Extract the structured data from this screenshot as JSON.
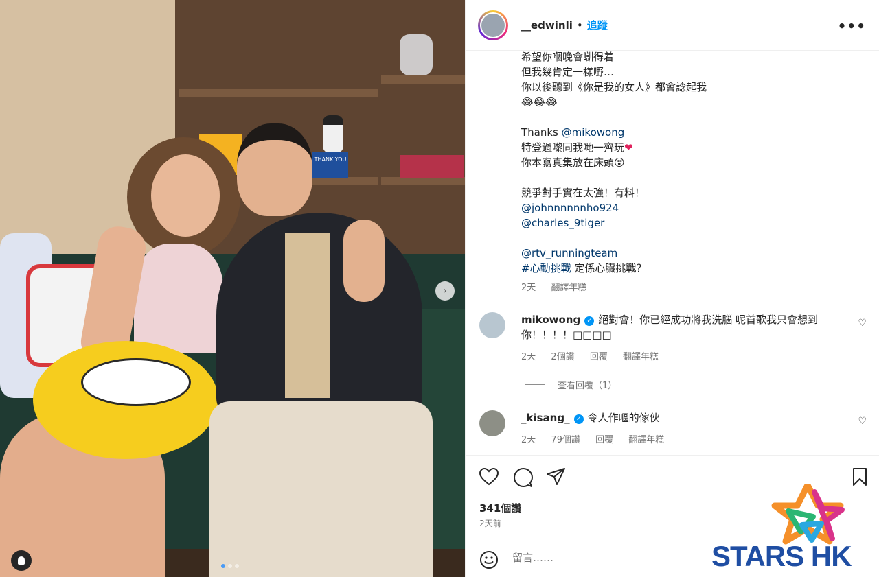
{
  "post": {
    "username": "__edwinli",
    "follow_label": "追蹤",
    "separator": "•",
    "more_label": "•••"
  },
  "photo": {
    "sign_text": "THANK YOU",
    "carousel_index": 1,
    "carousel_total": 3
  },
  "caption": {
    "lines": [
      "希望你嗰晚會瞓得着",
      "但我幾肯定一樣嘢…",
      "你以後聽到《你是我的女人》都會諗起我",
      "😂😂😂",
      "",
      "Thanks @mikowong",
      "特登過嚟同我哋一齊玩",
      "你本寫真集放在床頭😵",
      "",
      "競爭對手實在太強！有料！",
      "@johnnnnnnho924",
      "@charles_9tiger",
      "",
      "@rtv_runningteam",
      "#心動挑戰 定係心臟挑戰？"
    ],
    "thanks_prefix": "Thanks ",
    "mention_miko": "@mikowong",
    "line_visit": "特登過嚟同我哋一齊玩",
    "heart": "❤",
    "mention_john": "@johnnnnnnho924",
    "mention_charles": "@charles_9tiger",
    "mention_rtv": "@rtv_runningteam",
    "hashtag": "#心動挑戰",
    "hashtag_rest": " 定係心臟挑戰？",
    "time": "2天",
    "translate": "翻譯年糕"
  },
  "comments": [
    {
      "username": "mikowong",
      "text_line1": "絕對會！你已經成功將我洗腦 呢首歌我只會想到",
      "text_line2": "你！！！！□□□□",
      "time": "2天",
      "likes": "2個讚",
      "reply": "回覆",
      "translate": "翻譯年糕",
      "view_replies": "查看回覆（1）"
    },
    {
      "username": "_kisang_",
      "text": "令人作嘔的傢伙",
      "time": "2天",
      "likes": "79個讚",
      "reply": "回覆",
      "translate": "翻譯年糕"
    }
  ],
  "actions": {
    "likes_count": "341個讚",
    "posted_ago": "2天前"
  },
  "add_comment": {
    "placeholder": "留言……"
  },
  "watermark": {
    "text": "STARS HK"
  },
  "colors": {
    "link": "#00376b",
    "follow": "#0095f6",
    "meta": "#737373",
    "watermark": "#1f4ea3"
  }
}
